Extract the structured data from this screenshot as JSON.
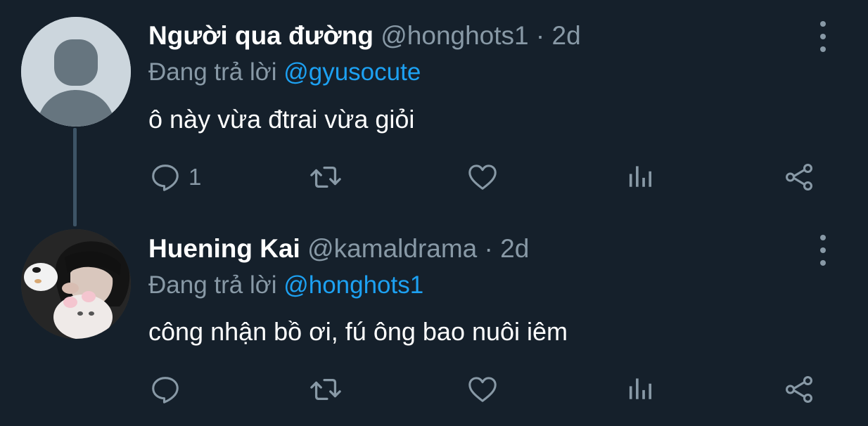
{
  "replying_prefix": "Đang trả lời",
  "tweets": [
    {
      "name": "Người qua đường",
      "handle": "@honghots1",
      "separator": "·",
      "time": "2d",
      "replying_to": "@gyusocute",
      "text": "ô này vừa đtrai vừa giỏi",
      "reply_count": "1",
      "avatar": "default-profile-avatar"
    },
    {
      "name": "Huening Kai",
      "handle": "@kamaldrama",
      "separator": "·",
      "time": "2d",
      "replying_to": "@honghots1",
      "text": "công nhận bồ ơi, fú ông bao nuôi iêm",
      "reply_count": "",
      "avatar": "profile-photo-with-plush-toys"
    }
  ],
  "colors": {
    "background": "#15202b",
    "primary_text": "#ffffff",
    "secondary_text": "#8899a6",
    "accent": "#1da1f2",
    "thread_line": "#3d5466"
  },
  "icons": {
    "reply": "reply-icon",
    "retweet": "retweet-icon",
    "like": "heart-icon",
    "stats": "stats-icon",
    "share": "share-icon",
    "more": "more-vertical-icon"
  }
}
